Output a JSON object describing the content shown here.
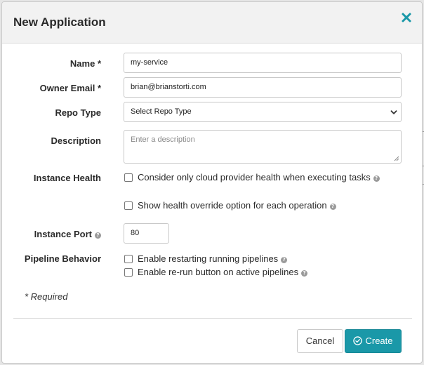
{
  "dialog": {
    "title": "New Application",
    "close_icon": "close-x-icon",
    "accent_color": "#1a98a8"
  },
  "form": {
    "name": {
      "label": "Name *",
      "value": "my-service"
    },
    "owner_email": {
      "label": "Owner Email *",
      "value": "brian@brianstorti.com"
    },
    "repo_type": {
      "label": "Repo Type",
      "selected": "Select Repo Type"
    },
    "description": {
      "label": "Description",
      "placeholder": "Enter a description"
    },
    "instance_health": {
      "label": "Instance Health",
      "options": [
        {
          "label": "Consider only cloud provider health when executing tasks",
          "checked": false
        },
        {
          "label": "Show health override option for each operation",
          "checked": false
        }
      ]
    },
    "instance_port": {
      "label": "Instance Port",
      "value": "80"
    },
    "pipeline_behavior": {
      "label": "Pipeline Behavior",
      "options": [
        {
          "label": "Enable restarting running pipelines",
          "checked": false
        },
        {
          "label": "Enable re-run button on active pipelines",
          "checked": false
        }
      ]
    },
    "required_note": "* Required"
  },
  "footer": {
    "cancel_label": "Cancel",
    "create_label": "Create",
    "create_icon": "check-circle-icon"
  }
}
